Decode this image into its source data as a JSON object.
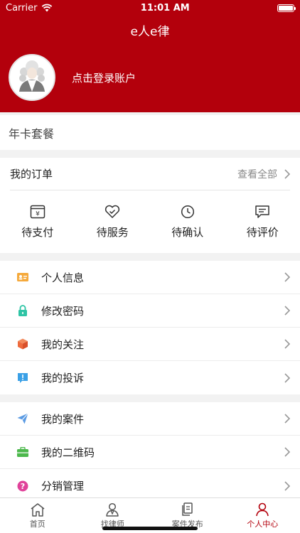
{
  "status_bar": {
    "carrier": "Carrier",
    "time": "11:01 AM"
  },
  "header": {
    "title": "e人e律",
    "login_prompt": "点击登录账户"
  },
  "annual_card": {
    "label": "年卡套餐"
  },
  "orders": {
    "title": "我的订单",
    "view_all": "查看全部",
    "items": [
      {
        "label": "待支付",
        "icon": "yuan-wallet-icon"
      },
      {
        "label": "待服务",
        "icon": "heart-check-icon"
      },
      {
        "label": "待确认",
        "icon": "clock-icon"
      },
      {
        "label": "待评价",
        "icon": "comment-icon"
      }
    ]
  },
  "menu": [
    {
      "label": "个人信息",
      "icon": "id-card-icon",
      "color": "#f5a93b"
    },
    {
      "label": "修改密码",
      "icon": "lock-icon",
      "color": "#2ec4a5"
    },
    {
      "label": "我的关注",
      "icon": "cube-icon",
      "color": "#ee6a3c"
    },
    {
      "label": "我的投诉",
      "icon": "alert-bubble-icon",
      "color": "#3aa0e6"
    }
  ],
  "menu2": [
    {
      "label": "我的案件",
      "icon": "paper-plane-icon",
      "color": "#5b9be3"
    },
    {
      "label": "我的二维码",
      "icon": "briefcase-icon",
      "color": "#4cb84c"
    },
    {
      "label": "分销管理",
      "icon": "question-circle-icon",
      "color": "#e0429a"
    }
  ],
  "tabbar": [
    {
      "label": "首页",
      "icon": "home-icon",
      "active": false
    },
    {
      "label": "找律师",
      "icon": "lawyer-icon",
      "active": false
    },
    {
      "label": "案件发布",
      "icon": "document-icon",
      "active": false
    },
    {
      "label": "个人中心",
      "icon": "person-icon",
      "active": true
    }
  ],
  "colors": {
    "brand": "#b3000c",
    "background": "#f2f2f2"
  }
}
